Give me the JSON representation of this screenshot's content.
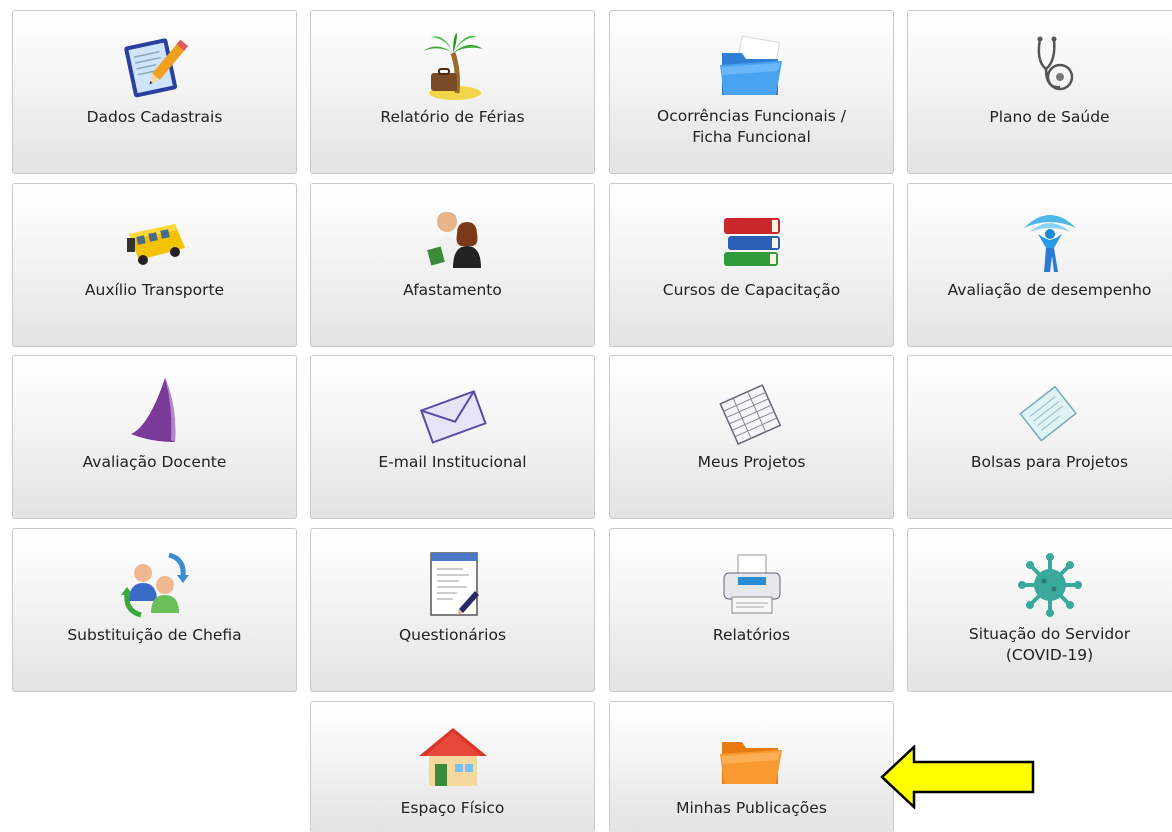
{
  "tiles": [
    {
      "label": "Dados Cadastrais",
      "icon": "edit-document-icon"
    },
    {
      "label": "Relatório de Férias",
      "icon": "palm-tree-suitcase-icon"
    },
    {
      "label": "Ocorrências Funcionais /\nFicha Funcional",
      "icon": "blue-folder-icon"
    },
    {
      "label": "Plano de Saúde",
      "icon": "stethoscope-icon"
    },
    {
      "label": "Auxílio Transporte",
      "icon": "school-bus-icon"
    },
    {
      "label": "Afastamento",
      "icon": "people-icon"
    },
    {
      "label": "Cursos de Capacitação",
      "icon": "books-stack-icon"
    },
    {
      "label": "Avaliação de desempenho",
      "icon": "performance-person-icon"
    },
    {
      "label": "Avaliação Docente",
      "icon": "purple-sail-icon"
    },
    {
      "label": "E-mail Institucional",
      "icon": "envelope-icon"
    },
    {
      "label": "Meus Projetos",
      "icon": "spreadsheet-icon"
    },
    {
      "label": "Bolsas para Projetos",
      "icon": "document-sheet-icon"
    },
    {
      "label": "Substituição de Chefia",
      "icon": "user-swap-icon"
    },
    {
      "label": "Questionários",
      "icon": "text-editor-icon"
    },
    {
      "label": "Relatórios",
      "icon": "printer-icon"
    },
    {
      "label": "Situação do Servidor\n(COVID-19)",
      "icon": "virus-icon"
    },
    {
      "label": "Espaço Físico",
      "icon": "house-icon"
    },
    {
      "label": "Minhas Publicações",
      "icon": "orange-folder-icon"
    }
  ],
  "annotation": {
    "icon": "yellow-arrow-left-icon",
    "color": "#ffff00"
  }
}
